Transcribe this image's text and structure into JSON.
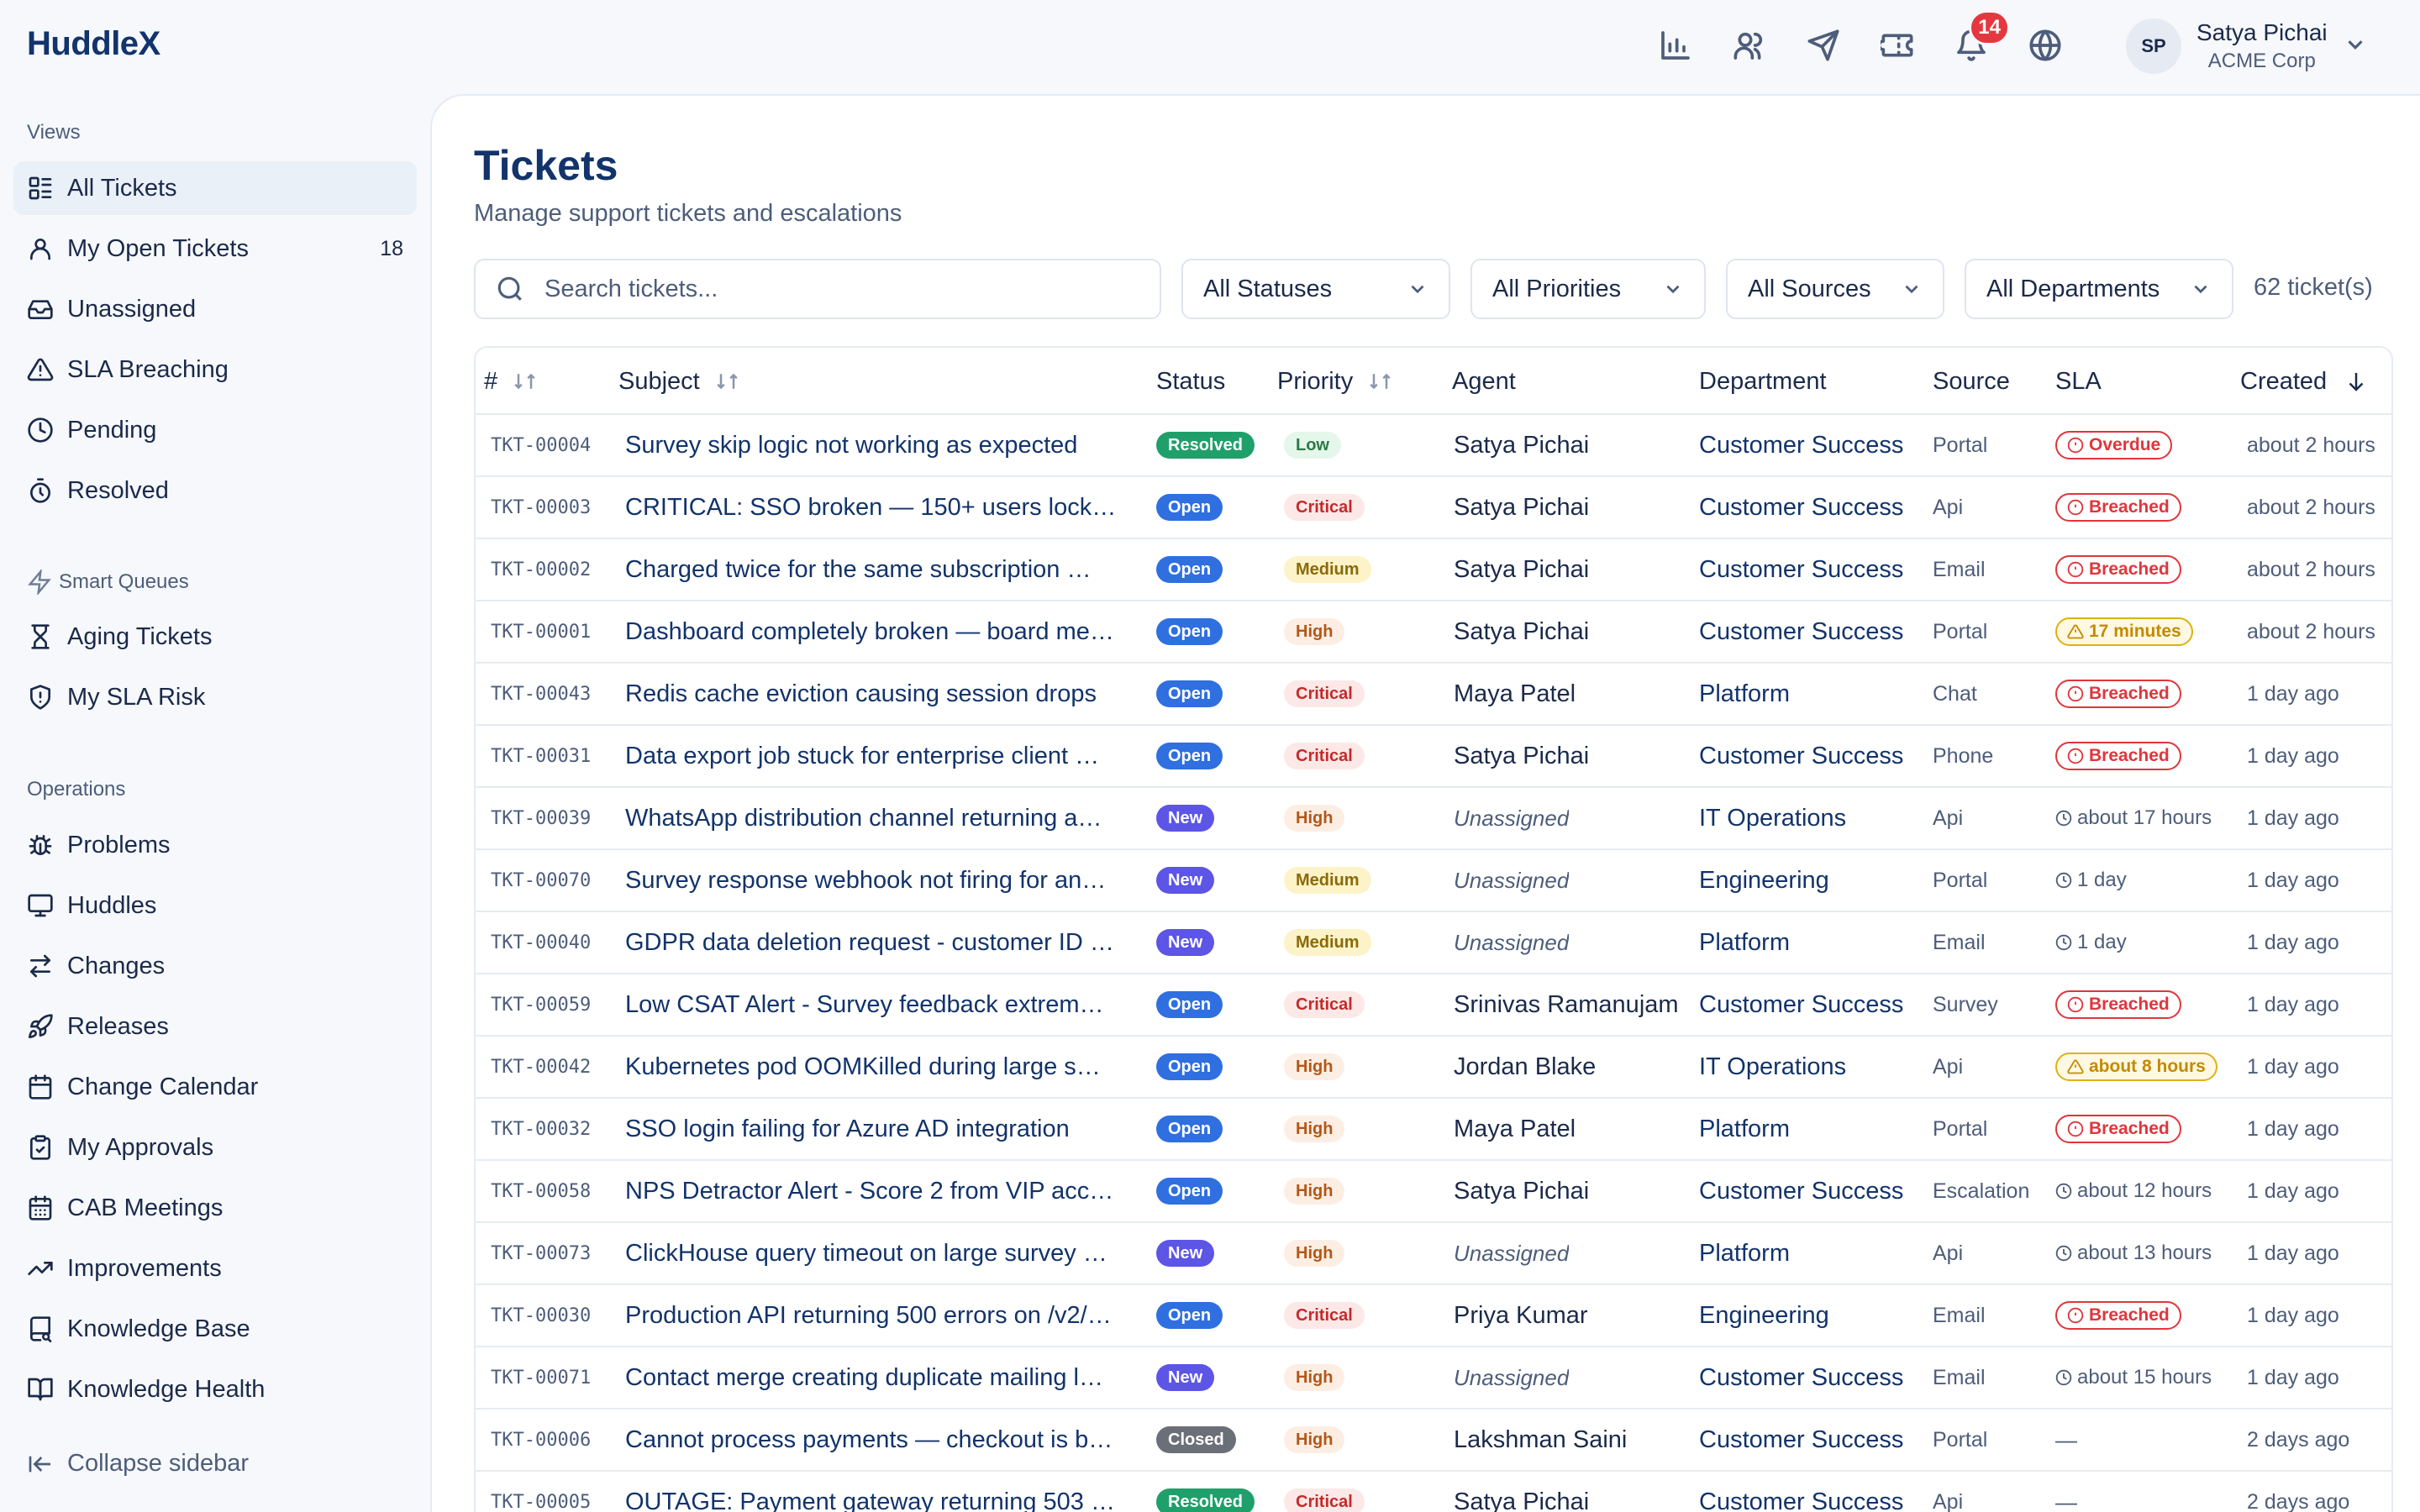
{
  "app": {
    "logo": "HuddleX"
  },
  "topbar": {
    "icons": [
      "bar-chart-icon",
      "users-icon",
      "send-icon",
      "ticket-icon",
      "bell-icon",
      "globe-icon"
    ],
    "notification_count": "14",
    "user": {
      "initials": "SP",
      "name": "Satya Pichai",
      "org": "ACME Corp"
    }
  },
  "sidebar": {
    "views_label": "Views",
    "views": [
      {
        "label": "All Tickets",
        "icon": "list-icon",
        "active": true
      },
      {
        "label": "My Open Tickets",
        "icon": "user-icon",
        "count": "18"
      },
      {
        "label": "Unassigned",
        "icon": "inbox-icon"
      },
      {
        "label": "SLA Breaching",
        "icon": "alert-triangle-icon"
      },
      {
        "label": "Pending",
        "icon": "clock-icon"
      },
      {
        "label": "Resolved",
        "icon": "timer-icon"
      }
    ],
    "smart_label": "Smart Queues",
    "smart": [
      {
        "label": "Aging Tickets",
        "icon": "hourglass-icon"
      },
      {
        "label": "My SLA Risk",
        "icon": "shield-icon"
      }
    ],
    "ops_label": "Operations",
    "ops": [
      {
        "label": "Problems",
        "icon": "bug-icon"
      },
      {
        "label": "Huddles",
        "icon": "monitor-icon"
      },
      {
        "label": "Changes",
        "icon": "swap-icon"
      },
      {
        "label": "Releases",
        "icon": "rocket-icon"
      },
      {
        "label": "Change Calendar",
        "icon": "calendar-icon"
      },
      {
        "label": "My Approvals",
        "icon": "clipboard-check-icon"
      },
      {
        "label": "CAB Meetings",
        "icon": "calendar-grid-icon"
      },
      {
        "label": "Improvements",
        "icon": "trending-up-icon"
      },
      {
        "label": "Knowledge Base",
        "icon": "book-search-icon"
      },
      {
        "label": "Knowledge Health",
        "icon": "book-open-icon"
      }
    ],
    "collapse_label": "Collapse sidebar"
  },
  "main": {
    "title": "Tickets",
    "subtitle": "Manage support tickets and escalations",
    "search_placeholder": "Search tickets...",
    "filters": [
      "All Statuses",
      "All Priorities",
      "All Sources",
      "All Departments"
    ],
    "count_text": "62 ticket(s)"
  },
  "table": {
    "columns": {
      "id": "#",
      "subject": "Subject",
      "status": "Status",
      "priority": "Priority",
      "agent": "Agent",
      "department": "Department",
      "source": "Source",
      "sla": "SLA",
      "created": "Created"
    },
    "rows": [
      {
        "id": "TKT-00004",
        "subject": "Survey skip logic not working as expected",
        "status": "Resolved",
        "priority": "Low",
        "agent": "Satya Pichai",
        "department": "Customer Success",
        "source": "Portal",
        "sla": "Overdue",
        "sla_type": "red",
        "created": "about 2 hours"
      },
      {
        "id": "TKT-00003",
        "subject": "CRITICAL: SSO broken — 150+ users locke…",
        "status": "Open",
        "priority": "Critical",
        "agent": "Satya Pichai",
        "department": "Customer Success",
        "source": "Api",
        "sla": "Breached",
        "sla_type": "red",
        "created": "about 2 hours"
      },
      {
        "id": "TKT-00002",
        "subject": "Charged twice for the same subscription …",
        "status": "Open",
        "priority": "Medium",
        "agent": "Satya Pichai",
        "department": "Customer Success",
        "source": "Email",
        "sla": "Breached",
        "sla_type": "red",
        "created": "about 2 hours"
      },
      {
        "id": "TKT-00001",
        "subject": "Dashboard completely broken — board me…",
        "status": "Open",
        "priority": "High",
        "agent": "Satya Pichai",
        "department": "Customer Success",
        "source": "Portal",
        "sla": "17 minutes",
        "sla_type": "amber",
        "created": "about 2 hours"
      },
      {
        "id": "TKT-00043",
        "subject": "Redis cache eviction causing session drops",
        "status": "Open",
        "priority": "Critical",
        "agent": "Maya Patel",
        "department": "Platform",
        "source": "Chat",
        "sla": "Breached",
        "sla_type": "red",
        "created": "1 day ago"
      },
      {
        "id": "TKT-00031",
        "subject": "Data export job stuck for enterprise client …",
        "status": "Open",
        "priority": "Critical",
        "agent": "Satya Pichai",
        "department": "Customer Success",
        "source": "Phone",
        "sla": "Breached",
        "sla_type": "red",
        "created": "1 day ago"
      },
      {
        "id": "TKT-00039",
        "subject": "WhatsApp distribution channel returning a…",
        "status": "New",
        "priority": "High",
        "agent": "Unassigned",
        "department": "IT Operations",
        "source": "Api",
        "sla": "about 17 hours",
        "sla_type": "plain",
        "created": "1 day ago"
      },
      {
        "id": "TKT-00070",
        "subject": "Survey response webhook not firing for an…",
        "status": "New",
        "priority": "Medium",
        "agent": "Unassigned",
        "department": "Engineering",
        "source": "Portal",
        "sla": "1 day",
        "sla_type": "plain",
        "created": "1 day ago"
      },
      {
        "id": "TKT-00040",
        "subject": "GDPR data deletion request - customer ID …",
        "status": "New",
        "priority": "Medium",
        "agent": "Unassigned",
        "department": "Platform",
        "source": "Email",
        "sla": "1 day",
        "sla_type": "plain",
        "created": "1 day ago"
      },
      {
        "id": "TKT-00059",
        "subject": "Low CSAT Alert - Survey feedback extrem…",
        "status": "Open",
        "priority": "Critical",
        "agent": "Srinivas Ramanujam",
        "department": "Customer Success",
        "source": "Survey",
        "sla": "Breached",
        "sla_type": "red",
        "created": "1 day ago"
      },
      {
        "id": "TKT-00042",
        "subject": "Kubernetes pod OOMKilled during large s…",
        "status": "Open",
        "priority": "High",
        "agent": "Jordan Blake",
        "department": "IT Operations",
        "source": "Api",
        "sla": "about 8 hours",
        "sla_type": "amber",
        "created": "1 day ago"
      },
      {
        "id": "TKT-00032",
        "subject": "SSO login failing for Azure AD integration",
        "status": "Open",
        "priority": "High",
        "agent": "Maya Patel",
        "department": "Platform",
        "source": "Portal",
        "sla": "Breached",
        "sla_type": "red",
        "created": "1 day ago"
      },
      {
        "id": "TKT-00058",
        "subject": "NPS Detractor Alert - Score 2 from VIP acc…",
        "status": "Open",
        "priority": "High",
        "agent": "Satya Pichai",
        "department": "Customer Success",
        "source": "Escalation",
        "sla": "about 12 hours",
        "sla_type": "plain",
        "created": "1 day ago"
      },
      {
        "id": "TKT-00073",
        "subject": "ClickHouse query timeout on large survey …",
        "status": "New",
        "priority": "High",
        "agent": "Unassigned",
        "department": "Platform",
        "source": "Api",
        "sla": "about 13 hours",
        "sla_type": "plain",
        "created": "1 day ago"
      },
      {
        "id": "TKT-00030",
        "subject": "Production API returning 500 errors on /v2/…",
        "status": "Open",
        "priority": "Critical",
        "agent": "Priya Kumar",
        "department": "Engineering",
        "source": "Email",
        "sla": "Breached",
        "sla_type": "red",
        "created": "1 day ago"
      },
      {
        "id": "TKT-00071",
        "subject": "Contact merge creating duplicate mailing l…",
        "status": "New",
        "priority": "High",
        "agent": "Unassigned",
        "department": "Customer Success",
        "source": "Email",
        "sla": "about 15 hours",
        "sla_type": "plain",
        "created": "1 day ago"
      },
      {
        "id": "TKT-00006",
        "subject": "Cannot process payments — checkout is b…",
        "status": "Closed",
        "priority": "High",
        "agent": "Lakshman Saini",
        "department": "Customer Success",
        "source": "Portal",
        "sla": "—",
        "sla_type": "none",
        "created": "2 days ago"
      },
      {
        "id": "TKT-00005",
        "subject": "OUTAGE: Payment gateway returning 503 …",
        "status": "Resolved",
        "priority": "Critical",
        "agent": "Satya Pichai",
        "department": "Customer Success",
        "source": "Api",
        "sla": "—",
        "sla_type": "none",
        "created": "2 days ago"
      }
    ]
  }
}
